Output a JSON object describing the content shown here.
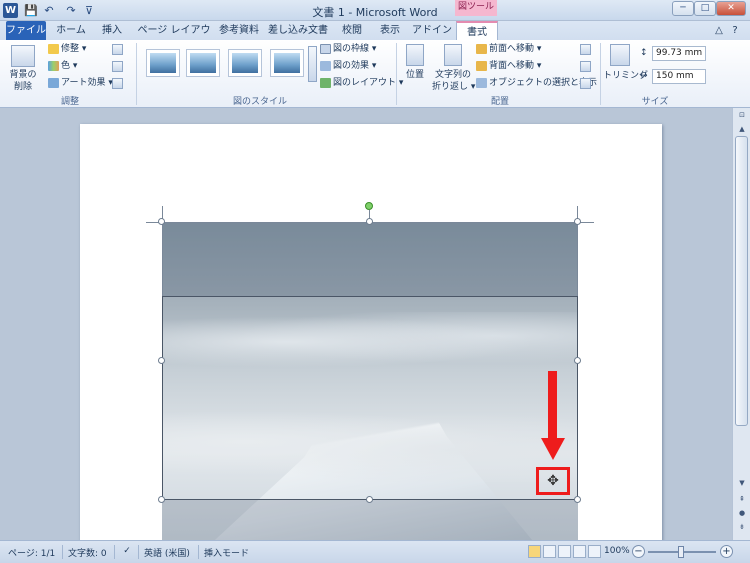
{
  "window": {
    "title": "文書 1 - Microsoft Word",
    "context_tab_group": "図ツール",
    "minimize": "─",
    "maximize": "□",
    "close": "✕",
    "word_logo": "W",
    "qat": [
      "💾",
      "↶",
      "↷",
      "⊽"
    ]
  },
  "tabs": [
    "ファイル",
    "ホーム",
    "挿入",
    "ページ レイアウト",
    "参考資料",
    "差し込み文書",
    "校閲",
    "表示",
    "アドイン",
    "書式"
  ],
  "tab_extras": {
    "minimize_ribbon": "△",
    "help": "?"
  },
  "ribbon": {
    "adjust": {
      "remove_bg": "背景の\n削除",
      "remove_bg_line1": "背景の",
      "remove_bg_line2": "削除",
      "corrections": "修整 ▾",
      "color": "色 ▾",
      "art_effects": "アート効果 ▾",
      "label": "調整"
    },
    "styles": {
      "border": "図の枠線 ▾",
      "effects": "図の効果 ▾",
      "layout": "図のレイアウト ▾",
      "label": "図のスタイル"
    },
    "arrange": {
      "position": "位置",
      "wrap_line1": "文字列の",
      "wrap_line2": "折り返し ▾",
      "bring_forward": "前面へ移動 ▾",
      "send_backward": "背面へ移動 ▾",
      "selection_pane": "オブジェクトの選択と表示",
      "label": "配置"
    },
    "size": {
      "crop": "トリミング",
      "height": "99.73 mm",
      "width": "150 mm",
      "label": "サイズ"
    }
  },
  "statusbar": {
    "page": "ページ: 1/1",
    "words": "文字数: 0",
    "language": "英語 (米国)",
    "mode": "挿入モード",
    "zoom": "100%",
    "zoom_minus": "−",
    "zoom_plus": "+"
  },
  "icons": {
    "move_cursor": "✥",
    "scroll_up": "▲",
    "scroll_down": "▼",
    "prev_page": "⇞",
    "next_page": "⇟",
    "browse_object": "●"
  },
  "colors": {
    "accent": "#2a63b8",
    "annotation": "#ee1c1c",
    "context_tab": "#f5b7cf"
  }
}
